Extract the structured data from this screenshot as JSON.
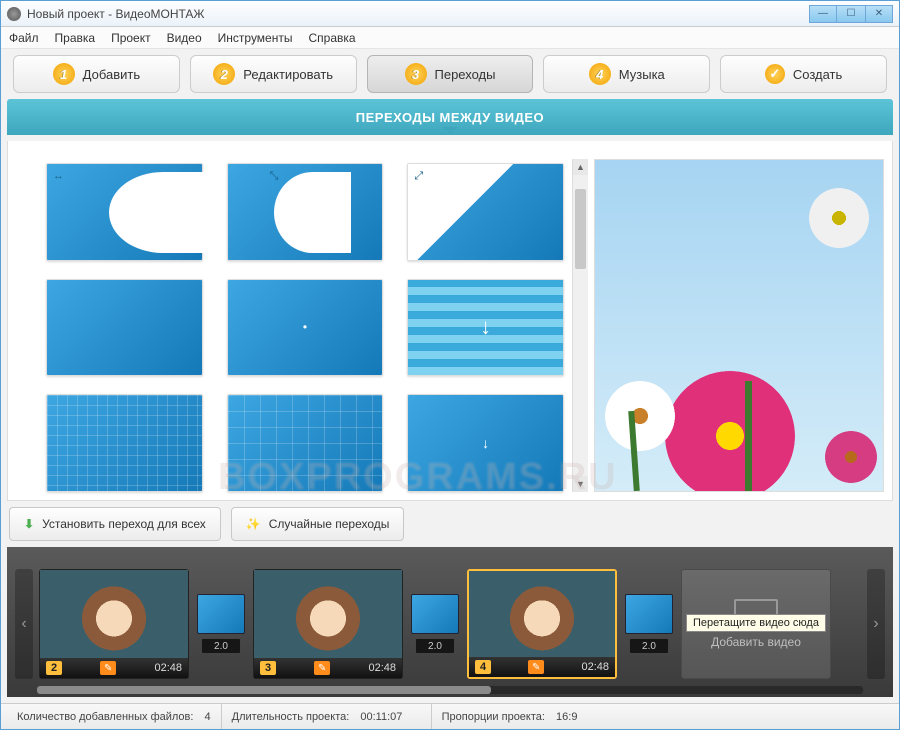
{
  "window": {
    "title": "Новый проект - ВидеоМОНТАЖ"
  },
  "menu": [
    "Файл",
    "Правка",
    "Проект",
    "Видео",
    "Инструменты",
    "Справка"
  ],
  "tabs": [
    {
      "num": "1",
      "label": "Добавить"
    },
    {
      "num": "2",
      "label": "Редактировать"
    },
    {
      "num": "3",
      "label": "Переходы",
      "active": true
    },
    {
      "num": "4",
      "label": "Музыка"
    },
    {
      "check": true,
      "label": "Создать"
    }
  ],
  "banner": "ПЕРЕХОДЫ МЕЖДУ ВИДЕО",
  "buttons": {
    "apply_all": "Установить переход для всех",
    "random": "Случайные переходы"
  },
  "timeline": {
    "clips": [
      {
        "index": "2",
        "duration": "02:48"
      },
      {
        "index": "3",
        "duration": "02:48"
      },
      {
        "index": "4",
        "duration": "02:48",
        "selected": true
      }
    ],
    "transition_duration": "2.0",
    "add_slot": {
      "label": "Добавить видео",
      "tooltip": "Перетащите видео сюда"
    }
  },
  "status": {
    "files_label": "Количество добавленных файлов:",
    "files_value": "4",
    "length_label": "Длительность проекта:",
    "length_value": "00:11:07",
    "ratio_label": "Пропорции проекта:",
    "ratio_value": "16:9"
  },
  "watermark": "BOXPROGRAMS.RU"
}
